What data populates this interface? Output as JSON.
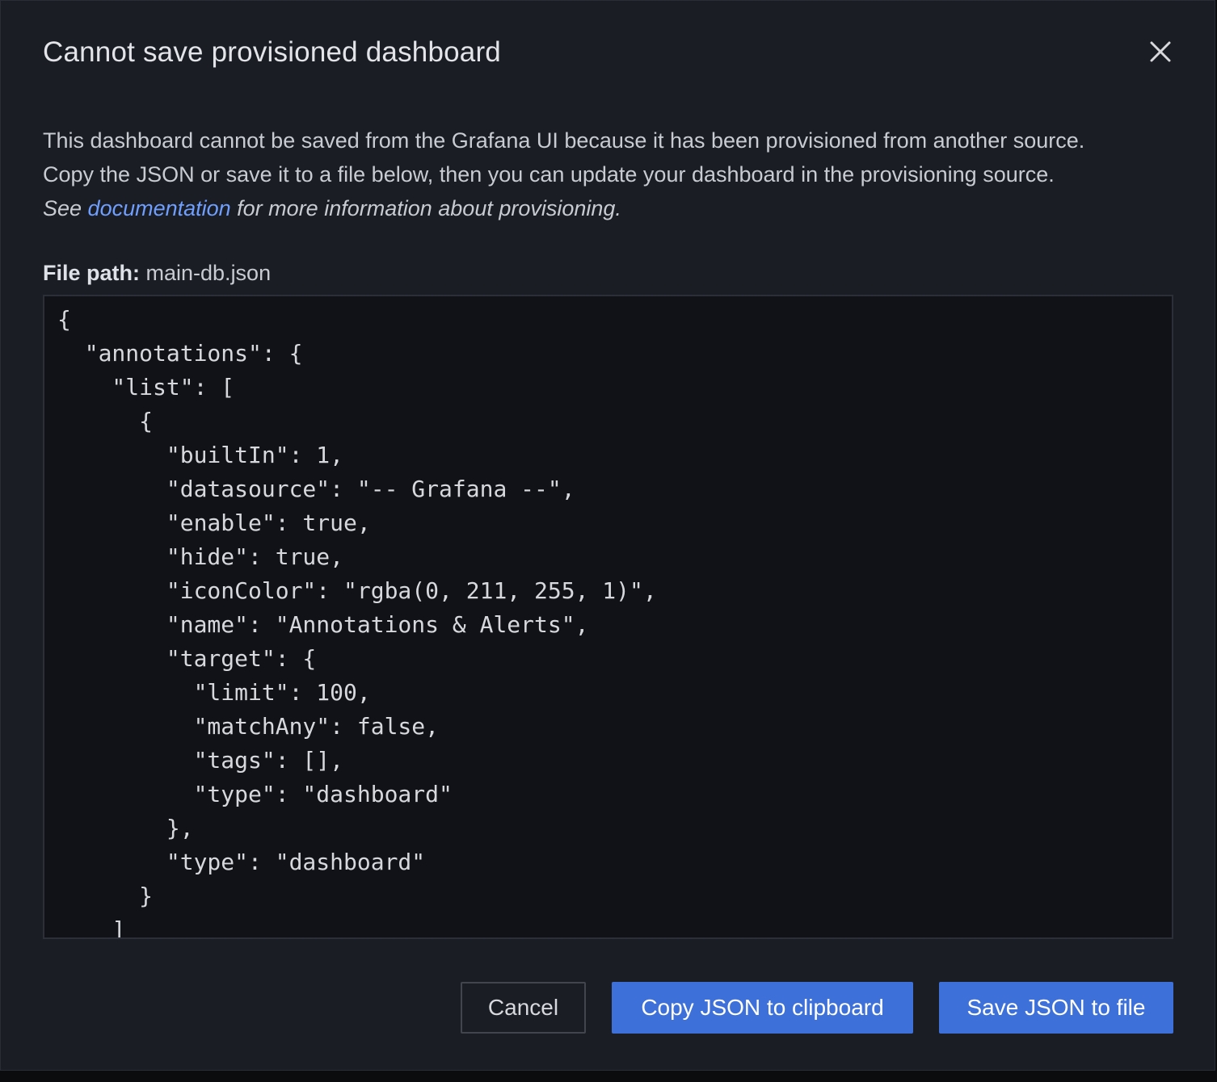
{
  "modal": {
    "title": "Cannot save provisioned dashboard",
    "description": {
      "line1": "This dashboard cannot be saved from the Grafana UI because it has been provisioned from another source.",
      "line2": "Copy the JSON or save it to a file below, then you can update your dashboard in the provisioning source.",
      "line3_prefix": "See ",
      "line3_link": "documentation",
      "line3_suffix": " for more information about provisioning."
    },
    "file_path": {
      "label": "File path:",
      "value": "main-db.json"
    },
    "json_content": "{\n  \"annotations\": {\n    \"list\": [\n      {\n        \"builtIn\": 1,\n        \"datasource\": \"-- Grafana --\",\n        \"enable\": true,\n        \"hide\": true,\n        \"iconColor\": \"rgba(0, 211, 255, 1)\",\n        \"name\": \"Annotations & Alerts\",\n        \"target\": {\n          \"limit\": 100,\n          \"matchAny\": false,\n          \"tags\": [],\n          \"type\": \"dashboard\"\n        },\n        \"type\": \"dashboard\"\n      }\n    ]",
    "buttons": {
      "cancel": "Cancel",
      "copy": "Copy JSON to clipboard",
      "save": "Save JSON to file"
    }
  },
  "colors": {
    "modal_bg": "#1b1d24",
    "code_bg": "#111217",
    "primary": "#3d71d9",
    "link": "#6e9fff"
  },
  "icons": {
    "close": "close-icon"
  }
}
